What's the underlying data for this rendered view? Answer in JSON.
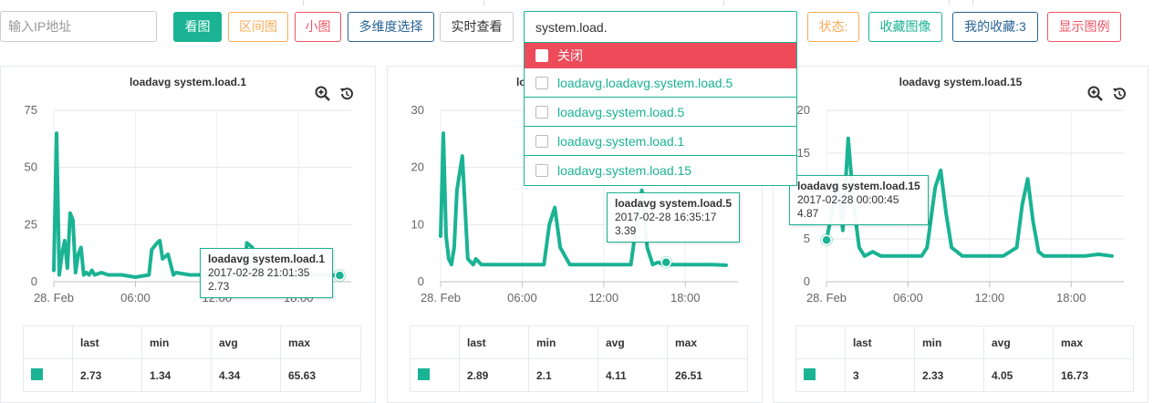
{
  "toolbar": {
    "ip_placeholder": "输入IP地址",
    "view_button": "看图",
    "range_button": "区间图",
    "small_button": "小图",
    "multi_button": "多维度选择",
    "realtime_button": "实时查看",
    "metric_value": "system.load.",
    "status_button": "状态:",
    "favorite_button": "收藏图像",
    "my_favorites_button": "我的收藏:3",
    "legend_button": "显示图例"
  },
  "dropdown": {
    "close_label": "关闭",
    "items": [
      "loadavg.loadavg.system.load.5",
      "loadavg.system.load.5",
      "loadavg.system.load.1",
      "loadavg.system.load.15"
    ]
  },
  "colors": {
    "accent": "#1ab394",
    "danger": "#ed4a5a"
  },
  "icons": {
    "zoom": "zoom-in-icon",
    "reset": "reset-zoom-icon"
  },
  "stats_headers": [
    "",
    "last",
    "min",
    "avg",
    "max"
  ],
  "charts": [
    {
      "title": "loadavg system.load.1",
      "tooltip": {
        "name": "loadavg system.load.1",
        "time": "2017-02-28 21:01:35",
        "value": "2.73"
      },
      "stats": {
        "last": "2.73",
        "min": "1.34",
        "avg": "4.34",
        "max": "65.63"
      },
      "chart_data": {
        "type": "line",
        "ylim": [
          0,
          75
        ],
        "yticks": [
          "75",
          "50",
          "25",
          "0"
        ],
        "xticks": [
          "28. Feb",
          "06:00",
          "12:00",
          "18:00"
        ],
        "x_hours": [
          0.0,
          0.2,
          0.4,
          0.6,
          0.8,
          1.0,
          1.2,
          1.4,
          1.6,
          1.8,
          2.0,
          2.2,
          2.4,
          2.6,
          2.8,
          3.0,
          3.5,
          4.0,
          5.0,
          6.0,
          7.0,
          7.2,
          7.6,
          7.8,
          8.0,
          8.4,
          8.8,
          9.0,
          10.0,
          12.0,
          14.0,
          14.2,
          14.6,
          15.0,
          15.4,
          16.0,
          18.0,
          20.0,
          21.0
        ],
        "values": [
          5,
          65,
          3,
          12,
          18,
          6,
          30,
          27,
          4,
          12,
          15,
          3,
          4,
          3,
          5,
          3,
          4,
          3,
          3,
          2,
          3,
          14,
          17,
          18,
          10,
          12,
          3,
          4,
          3,
          3,
          3,
          17,
          15,
          3,
          4,
          3,
          3,
          3,
          2.73
        ]
      }
    },
    {
      "title": "loadavg system.load.5",
      "tooltip": {
        "name": "loadavg system.load.5",
        "time": "2017-02-28 16:35:17",
        "value": "3.39"
      },
      "stats": {
        "last": "2.89",
        "min": "2.1",
        "avg": "4.11",
        "max": "26.51"
      },
      "chart_data": {
        "type": "line",
        "ylim": [
          0,
          30
        ],
        "yticks": [
          "30",
          "20",
          "10",
          "0"
        ],
        "xticks": [
          "28. Feb",
          "06:00",
          "12:00",
          "18:00"
        ],
        "x_hours": [
          0.0,
          0.2,
          0.4,
          0.6,
          0.8,
          1.0,
          1.2,
          1.6,
          2.0,
          2.4,
          2.6,
          3.0,
          3.6,
          4.0,
          5.0,
          6.0,
          7.0,
          7.6,
          8.0,
          8.4,
          8.8,
          9.5,
          10.5,
          12.0,
          13.0,
          14.0,
          14.4,
          14.8,
          15.2,
          15.6,
          16.0,
          16.4,
          17.0,
          18.0,
          19.0,
          20.0,
          21.0
        ],
        "values": [
          8,
          26,
          8,
          4,
          3,
          6,
          16,
          22,
          4,
          3,
          4,
          3,
          3,
          3,
          3,
          3,
          3,
          3,
          10,
          13,
          6,
          3,
          3,
          3,
          3,
          3,
          10,
          16,
          6,
          3,
          3.4,
          3,
          3,
          3,
          3,
          3,
          2.89
        ]
      }
    },
    {
      "title": "loadavg system.load.15",
      "tooltip": {
        "name": "loadavg system.load.15",
        "time": "2017-02-28 00:00:45",
        "value": "4.87"
      },
      "stats": {
        "last": "3",
        "min": "2.33",
        "avg": "4.05",
        "max": "16.73"
      },
      "chart_data": {
        "type": "line",
        "ylim": [
          0,
          20
        ],
        "yticks": [
          "20",
          "15",
          "10",
          "5",
          "0"
        ],
        "xticks": [
          "28. Feb",
          "06:00",
          "12:00",
          "18:00"
        ],
        "x_hours": [
          0.0,
          0.4,
          0.8,
          1.2,
          1.6,
          2.0,
          2.4,
          2.8,
          3.4,
          4.0,
          5.0,
          6.0,
          7.0,
          7.4,
          8.0,
          8.4,
          8.8,
          9.2,
          10.0,
          11.0,
          12.0,
          13.0,
          14.0,
          14.4,
          14.8,
          15.2,
          15.6,
          16.0,
          17.0,
          18.0,
          19.0,
          20.0,
          21.0
        ],
        "values": [
          4.87,
          8,
          12,
          6,
          16.73,
          9,
          4,
          3,
          3.5,
          3,
          3,
          3,
          3,
          4,
          11,
          13,
          8,
          4,
          3,
          3,
          3,
          3,
          4,
          9,
          12,
          7,
          3.5,
          3,
          3,
          3,
          3,
          3.2,
          3
        ]
      }
    }
  ]
}
